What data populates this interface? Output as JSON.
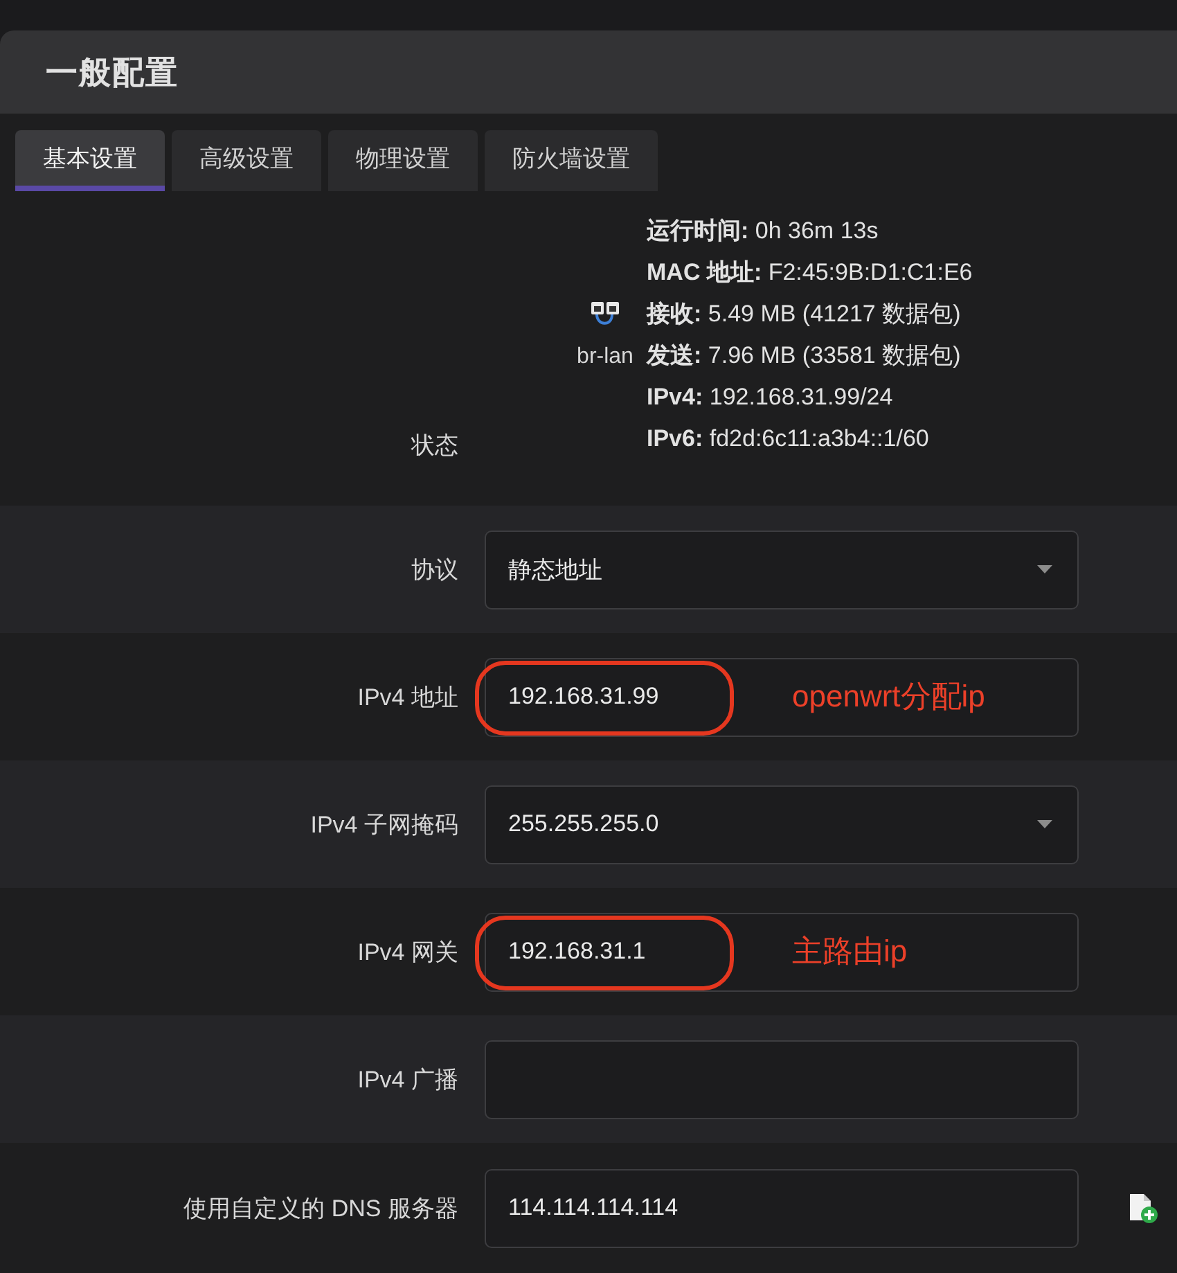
{
  "section": {
    "title": "一般配置"
  },
  "tabs": [
    {
      "label": "基本设置",
      "selected": true
    },
    {
      "label": "高级设置",
      "selected": false
    },
    {
      "label": "物理设置",
      "selected": false
    },
    {
      "label": "防火墙设置",
      "selected": false
    }
  ],
  "status": {
    "label": "状态",
    "interface": "br-lan",
    "lines": [
      "**运行时间:** 0h 36m 13s",
      "**MAC 地址:** F2:45:9B:D1:C1:E6",
      "**接收:** 5.49 MB (41217 数据包)",
      "**发送:** 7.96 MB (33581 数据包)",
      "**IPv4:** 192.168.31.99/24",
      "**IPv6:** fd2d:6c11:a3b4::1/60"
    ]
  },
  "fields": [
    {
      "kind": "select",
      "label": "协议",
      "value": "静态地址"
    },
    {
      "kind": "text",
      "label": "IPv4 地址",
      "value": "192.168.31.99",
      "note": "openwrt分配ip"
    },
    {
      "kind": "select",
      "label": "IPv4 子网掩码",
      "value": "255.255.255.0"
    },
    {
      "kind": "text",
      "label": "IPv4 网关",
      "value": "192.168.31.1",
      "note": "主路由ip"
    },
    {
      "kind": "text",
      "label": "IPv4 广播"
    },
    {
      "kind": "list",
      "label": "使用自定义的 DNS 服务器",
      "value": "114.114.114.114"
    }
  ]
}
